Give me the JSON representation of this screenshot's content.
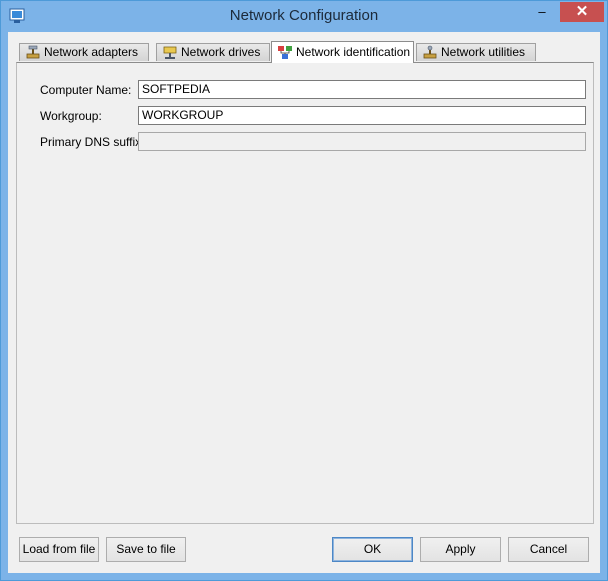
{
  "window": {
    "title": "Network Configuration",
    "minimize_glyph": "–",
    "close_glyph": "✕"
  },
  "tabs": [
    {
      "label": "Network adapters",
      "icon": "network-adapter-icon"
    },
    {
      "label": "Network drives",
      "icon": "network-drive-icon"
    },
    {
      "label": "Network identification",
      "icon": "network-identification-icon",
      "active": true
    },
    {
      "label": "Network utilities",
      "icon": "network-utilities-icon"
    }
  ],
  "form": {
    "computer_name_label": "Computer Name:",
    "computer_name_value": "SOFTPEDIA",
    "workgroup_label": "Workgroup:",
    "workgroup_value": "WORKGROUP",
    "dns_suffix_label": "Primary DNS suffix:",
    "dns_suffix_value": ""
  },
  "buttons": {
    "load_from_file": "Load from file",
    "save_to_file": "Save to file",
    "ok": "OK",
    "apply": "Apply",
    "cancel": "Cancel"
  },
  "colors": {
    "titlebar": "#7cb3e8",
    "close": "#c75050",
    "dialog_bg": "#f0f0f0"
  }
}
